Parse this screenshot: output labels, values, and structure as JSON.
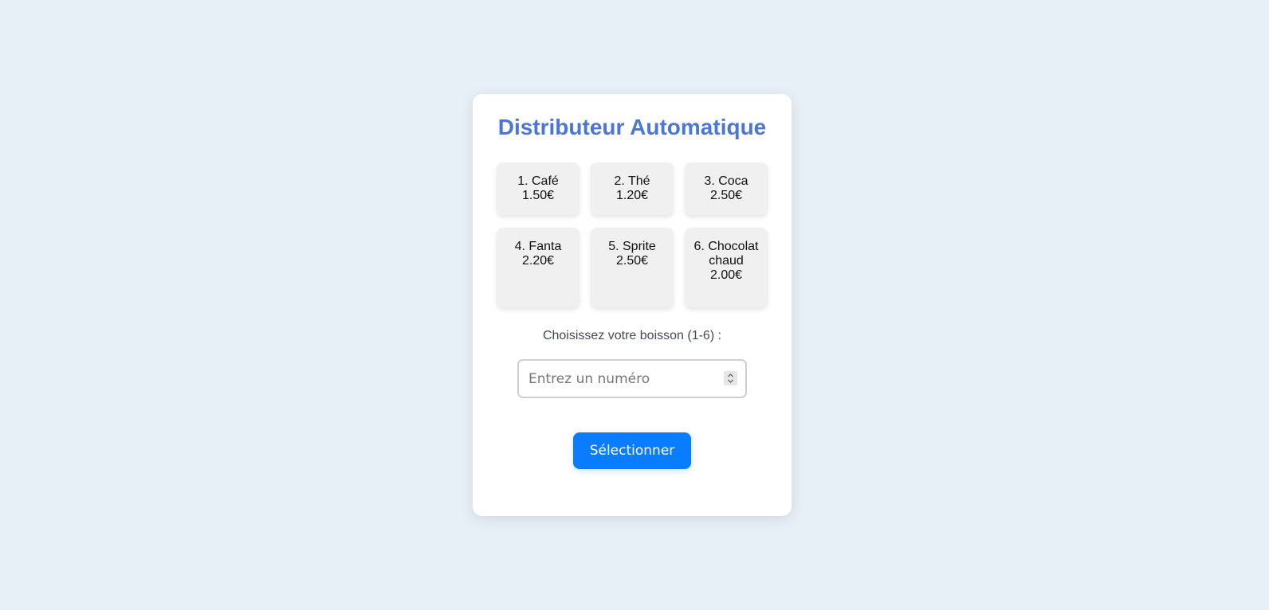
{
  "colors": {
    "background": "#e8f0f7",
    "card": "#ffffff",
    "title": "#4a76d8",
    "tile": "#f0f0f0",
    "button": "#0a7cff",
    "button_text": "#ffffff"
  },
  "title": "Distributeur Automatique",
  "drinks": [
    {
      "label": "1. Café",
      "price": "1.50€"
    },
    {
      "label": "2. Thé",
      "price": "1.20€"
    },
    {
      "label": "3. Coca",
      "price": "2.50€"
    },
    {
      "label": "4. Fanta",
      "price": "2.20€"
    },
    {
      "label": "5. Sprite",
      "price": "2.50€"
    },
    {
      "label": "6. Chocolat chaud",
      "price": "2.00€"
    }
  ],
  "prompt": "Choisissez votre boisson (1-6) :",
  "input": {
    "placeholder": "Entrez un numéro",
    "value": ""
  },
  "spinner_icon": "up-down-chevron-icon",
  "button_label": "Sélectionner"
}
